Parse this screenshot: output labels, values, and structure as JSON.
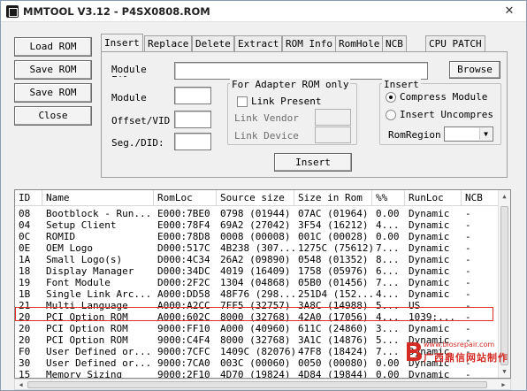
{
  "window": {
    "title": "MMTOOL V3.12 - P4SX0808.ROM",
    "close_glyph": "✕"
  },
  "side_buttons": {
    "load": "Load ROM",
    "save": "Save ROM",
    "save_as": "Save ROM as..",
    "close": "Close"
  },
  "tabs": [
    "Insert",
    "Replace",
    "Delete",
    "Extract",
    "ROM Info",
    "RomHole",
    "NCB",
    "CPU PATCH"
  ],
  "insert_panel": {
    "module_file_label": "Module\nFile",
    "module_label": "Module",
    "offset_label": "Offset/VID",
    "seg_label": "Seg./DID:",
    "browse": "Browse",
    "insert": "Insert",
    "adapter_group": {
      "title": "For Adapter ROM only",
      "link_present": "Link Present",
      "link_vendor": "Link Vendor",
      "link_device": "Link Device"
    },
    "insert_group": {
      "title": "Insert",
      "compress": "Compress Module",
      "uncompress": "Insert Uncompres",
      "rom_region": "RomRegion"
    }
  },
  "table": {
    "columns": [
      "ID",
      "Name",
      "RomLoc",
      "Source size",
      "Size in Rom",
      "%%",
      "RunLoc",
      "NCB"
    ],
    "rows": [
      [
        "08",
        "Bootblock - Run...",
        "E000:7BE0",
        "0798 (01944)",
        "07AC (01964)",
        "0.00",
        "Dynamic",
        "-"
      ],
      [
        "04",
        "Setup Client",
        "E000:78F4",
        "69A2 (27042)",
        "3F54 (16212)",
        "4...",
        "Dynamic",
        "-"
      ],
      [
        "0C",
        "ROMID",
        "E000:78D8",
        "0008 (00008)",
        "001C (00028)",
        "0.00",
        "Dynamic",
        "-"
      ],
      [
        "0E",
        "OEM Logo",
        "D000:517C",
        "4B238 (307...",
        "1275C (75612)",
        "7...",
        "Dynamic",
        "-"
      ],
      [
        "1A",
        "Small Logo(s)",
        "D000:4C34",
        "26A2 (09890)",
        "0548 (01352)",
        "8...",
        "Dynamic",
        "-"
      ],
      [
        "18",
        "Display Manager",
        "D000:34DC",
        "4019 (16409)",
        "1758 (05976)",
        "6...",
        "Dynamic",
        "-"
      ],
      [
        "19",
        "Font Module",
        "D000:2F2C",
        "1304 (04868)",
        "05B0 (01456)",
        "7...",
        "Dynamic",
        "-"
      ],
      [
        "1B",
        "Single Link Arc...",
        "A000:DD58",
        "48F76 (298...",
        "251D4 (152...",
        "4...",
        "Dynamic",
        "-"
      ],
      [
        "21",
        "Multi Language",
        "A000:A2CC",
        "7FF5 (32757)",
        "3A8C (14988)",
        "5...",
        "US",
        "-"
      ],
      [
        "20",
        "PCI Option ROM",
        "A000:602C",
        "8000 (32768)",
        "42A0 (17056)",
        "4...",
        "1039:...",
        "-"
      ],
      [
        "20",
        "PCI Option ROM",
        "9000:FF10",
        "A000 (40960)",
        "611C (24860)",
        "3...",
        "Dynamic",
        "-"
      ],
      [
        "20",
        "PCI Option ROM",
        "9000:C4F4",
        "8000 (32768)",
        "3A1C (14876)",
        "5...",
        "Dynamic",
        "-"
      ],
      [
        "F0",
        "User Defined or...",
        "9000:7CFC",
        "1409C (82076)",
        "47F8 (18424)",
        "7...",
        "Dynamic",
        "-"
      ],
      [
        "30",
        "User Defined or...",
        "9000:7CA0",
        "003C (00060)",
        "0050 (00080)",
        "0.00",
        "Dynamic",
        "-"
      ],
      [
        "15",
        "Memory Sizing",
        "9000:2F10",
        "4D70 (19824)",
        "4D84 (19844)",
        "0.00",
        "Dynamic",
        "-"
      ]
    ],
    "highlight_color": "#e0302a"
  },
  "watermark": {
    "url": "www.biosrepair.com",
    "text": "广西鼎信网站制作",
    "color": "#d32a24"
  }
}
